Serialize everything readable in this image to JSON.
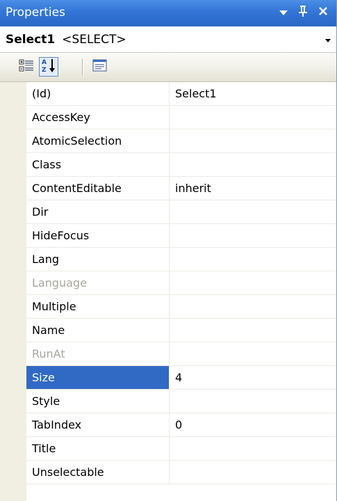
{
  "window": {
    "title": "Properties"
  },
  "object_selector": {
    "name": "Select1",
    "type": "<SELECT>"
  },
  "colors": {
    "title_bar": "#3375d6",
    "selected_row": "#316ac5",
    "disabled_text": "#a8a7a0"
  },
  "toolbar": {
    "buttons": [
      {
        "icon": "categorized-icon",
        "active": false
      },
      {
        "icon": "alphabetical-sort-icon",
        "active": true
      },
      {
        "icon": "property-pages-icon",
        "active": false
      }
    ]
  },
  "properties": [
    {
      "name": "(Id)",
      "value": "Select1"
    },
    {
      "name": "AccessKey",
      "value": ""
    },
    {
      "name": "AtomicSelection",
      "value": ""
    },
    {
      "name": "Class",
      "value": ""
    },
    {
      "name": "ContentEditable",
      "value": "inherit"
    },
    {
      "name": "Dir",
      "value": ""
    },
    {
      "name": "HideFocus",
      "value": ""
    },
    {
      "name": "Lang",
      "value": ""
    },
    {
      "name": "Language",
      "value": "",
      "disabled": true
    },
    {
      "name": "Multiple",
      "value": ""
    },
    {
      "name": "Name",
      "value": ""
    },
    {
      "name": "RunAt",
      "value": "",
      "disabled": true
    },
    {
      "name": "Size",
      "value": "4",
      "selected": true
    },
    {
      "name": "Style",
      "value": ""
    },
    {
      "name": "TabIndex",
      "value": "0"
    },
    {
      "name": "Title",
      "value": ""
    },
    {
      "name": "Unselectable",
      "value": ""
    }
  ]
}
